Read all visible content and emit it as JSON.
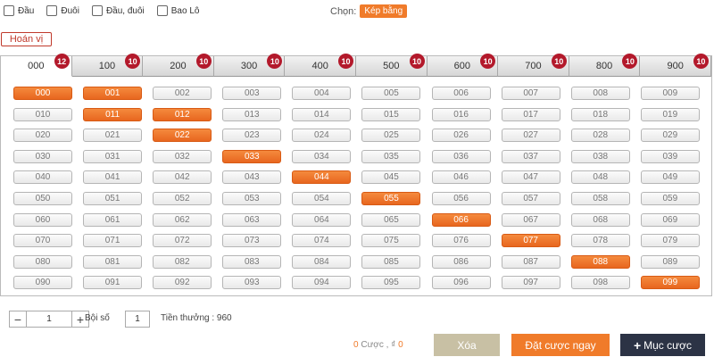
{
  "options": [
    {
      "label": "Đầu"
    },
    {
      "label": "Đuôi"
    },
    {
      "label": "Đầu, đuôi"
    },
    {
      "label": "Bao Lô"
    }
  ],
  "chon": {
    "label": "Chọn:",
    "value": "Kép bằng"
  },
  "hoanvi_label": "Hoán vị",
  "tabs": [
    {
      "label": "000",
      "count": "12",
      "active": true
    },
    {
      "label": "100",
      "count": "10"
    },
    {
      "label": "200",
      "count": "10"
    },
    {
      "label": "300",
      "count": "10"
    },
    {
      "label": "400",
      "count": "10"
    },
    {
      "label": "500",
      "count": "10"
    },
    {
      "label": "600",
      "count": "10"
    },
    {
      "label": "700",
      "count": "10"
    },
    {
      "label": "800",
      "count": "10"
    },
    {
      "label": "900",
      "count": "10"
    }
  ],
  "numbers": [
    "000",
    "001",
    "002",
    "003",
    "004",
    "005",
    "006",
    "007",
    "008",
    "009",
    "010",
    "011",
    "012",
    "013",
    "014",
    "015",
    "016",
    "017",
    "018",
    "019",
    "020",
    "021",
    "022",
    "023",
    "024",
    "025",
    "026",
    "027",
    "028",
    "029",
    "030",
    "031",
    "032",
    "033",
    "034",
    "035",
    "036",
    "037",
    "038",
    "039",
    "040",
    "041",
    "042",
    "043",
    "044",
    "045",
    "046",
    "047",
    "048",
    "049",
    "050",
    "051",
    "052",
    "053",
    "054",
    "055",
    "056",
    "057",
    "058",
    "059",
    "060",
    "061",
    "062",
    "063",
    "064",
    "065",
    "066",
    "067",
    "068",
    "069",
    "070",
    "071",
    "072",
    "073",
    "074",
    "075",
    "076",
    "077",
    "078",
    "079",
    "080",
    "081",
    "082",
    "083",
    "084",
    "085",
    "086",
    "087",
    "088",
    "089",
    "090",
    "091",
    "092",
    "093",
    "094",
    "095",
    "096",
    "097",
    "098",
    "099"
  ],
  "selected": [
    "000",
    "001",
    "011",
    "012",
    "022",
    "033",
    "044",
    "055",
    "066",
    "077",
    "088",
    "099"
  ],
  "colors": {
    "accent": "#f07b2a",
    "badge": "#b3192b",
    "dark_button": "#2c3345",
    "clear_button": "#c8c0a4"
  },
  "stepper": {
    "minus": "−",
    "value": "1",
    "plus": "+"
  },
  "boiso": {
    "label": "Bội số",
    "value": "1"
  },
  "reward": {
    "label": "Tiền thưởng :",
    "value": "960"
  },
  "summary": {
    "count": "0",
    "count_label": "Cược ,",
    "currency": "₫",
    "amount": "0"
  },
  "buttons": {
    "xoa": "Xóa",
    "dat_cuoc": "Đặt cược ngay",
    "muc_cuoc_icon": "+",
    "muc_cuoc": "Mục cược"
  }
}
